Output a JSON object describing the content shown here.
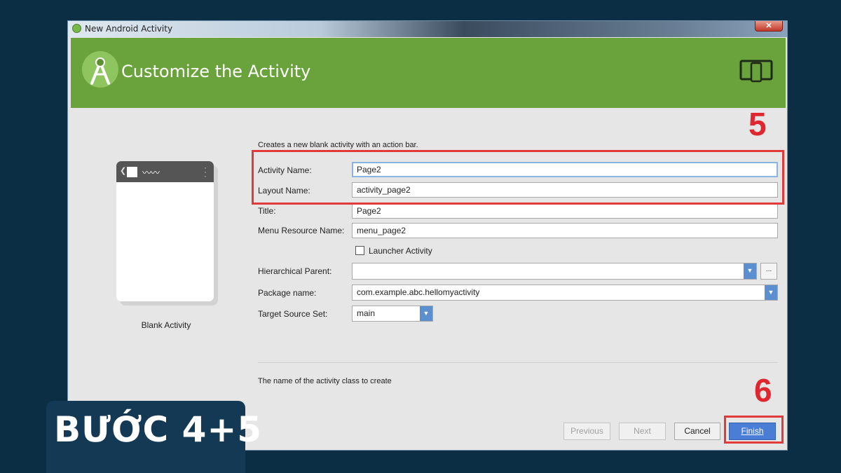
{
  "window": {
    "title": "New Android Activity",
    "close_label": "✕"
  },
  "header": {
    "title": "Customize the Activity",
    "background_color": "#6aa23b"
  },
  "preview": {
    "label": "Blank Activity",
    "wave_glyph": "〰〰"
  },
  "form": {
    "description": "Creates a new blank activity with an action bar.",
    "activity_name": {
      "label": "Activity Name:",
      "value": "Page2"
    },
    "layout_name": {
      "label": "Layout Name:",
      "value": "activity_page2"
    },
    "title": {
      "label": "Title:",
      "value": "Page2"
    },
    "menu_resource_name": {
      "label": "Menu Resource Name:",
      "value": "menu_page2"
    },
    "launcher_activity": {
      "label": "Launcher Activity",
      "checked": false
    },
    "hierarchical_parent": {
      "label": "Hierarchical Parent:",
      "value": "",
      "browse_label": "..."
    },
    "package_name": {
      "label": "Package name:",
      "value": "com.example.abc.hellomyactivity"
    },
    "target_source_set": {
      "label": "Target Source Set:",
      "value": "main"
    },
    "hint": "The name of the activity class to create"
  },
  "buttons": {
    "previous": "Previous",
    "next": "Next",
    "cancel": "Cancel",
    "finish": "Finish"
  },
  "annotations": {
    "step_5": "5",
    "step_6": "6",
    "badge": "BƯỚC 4+5",
    "highlight_color": "#e0262e"
  }
}
